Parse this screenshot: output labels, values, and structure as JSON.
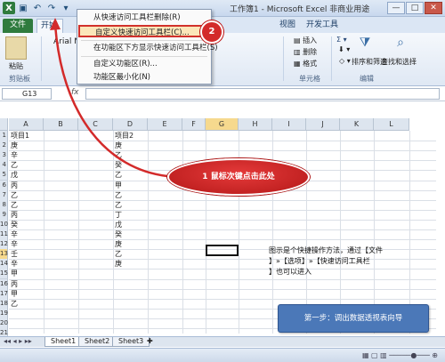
{
  "window": {
    "title": "工作簿1 - Microsoft Excel 非商业用途",
    "minimize": "—",
    "maximize": "□",
    "close": "✕"
  },
  "ribbon": {
    "tabs": [
      "文件",
      "开始",
      "视图",
      "开发工具"
    ],
    "font_name": "Arial N",
    "paste_label": "粘贴",
    "clipboard_group": "剪贴板",
    "cells_group": "单元格",
    "editing_group": "编辑",
    "insert_label": "插入",
    "delete_label": "删除",
    "format_label": "格式",
    "sort_filter_label": "排序和筛选",
    "find_select_label": "查找和选择"
  },
  "formula_bar": {
    "name_box": "G13",
    "fx": "fx"
  },
  "qat_menu": {
    "items": [
      "从快速访问工具栏删除(R)",
      "自定义快速访问工具栏(C)...",
      "在功能区下方显示快速访问工具栏(S)",
      "自定义功能区(R)...",
      "功能区最小化(N)"
    ],
    "highlighted_index": 1
  },
  "grid": {
    "columns": [
      "A",
      "B",
      "C",
      "D",
      "E",
      "F",
      "G",
      "H",
      "I",
      "J",
      "K",
      "L"
    ],
    "selected_column": "G",
    "selected_row": 13,
    "rows": [
      1,
      2,
      3,
      4,
      5,
      6,
      7,
      8,
      9,
      10,
      11,
      12,
      13,
      14,
      15,
      16,
      17,
      18,
      19,
      20,
      21
    ],
    "col_a": [
      "项目1",
      "庚",
      "辛",
      "乙",
      "戊",
      "丙",
      "乙",
      "乙",
      "丙",
      "癸",
      "辛",
      "辛",
      "壬",
      "辛",
      "甲",
      "丙",
      "甲",
      "乙"
    ],
    "col_d": [
      "项目2",
      "庚",
      "乙",
      "癸",
      "乙",
      "甲",
      "乙",
      "乙",
      "丁",
      "戊",
      "癸",
      "庚",
      "乙",
      "庚"
    ]
  },
  "annotations": {
    "step2_badge": "2",
    "step1_bubble": "1 鼠标次键点击此处",
    "note_line1": "图示是个快捷操作方法，通过【文件",
    "note_line2": "】»【选项】»【快速访问工具栏",
    "note_line3": "】也可以进入",
    "step_box": "第一步：调出数据透视表向导"
  },
  "sheets": {
    "tabs": [
      "Sheet1",
      "Sheet2",
      "Sheet3"
    ],
    "active": "Sheet1"
  },
  "colors": {
    "accent_red": "#d32a2a",
    "file_tab": "#2f7b3e",
    "step_box": "#4b78b8"
  }
}
